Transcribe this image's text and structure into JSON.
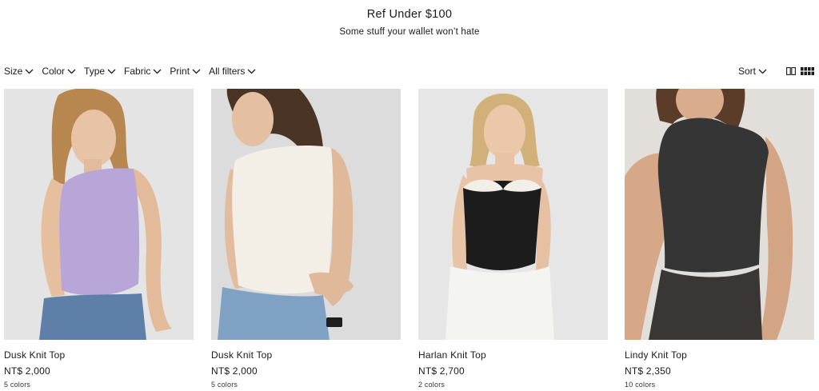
{
  "header": {
    "title": "Ref Under $100",
    "subtitle": "Some stuff your wallet won’t hate"
  },
  "filters": [
    {
      "label": "Size",
      "icon": "chevron-down-icon"
    },
    {
      "label": "Color",
      "icon": "chevron-down-icon"
    },
    {
      "label": "Type",
      "icon": "chevron-down-icon"
    },
    {
      "label": "Fabric",
      "icon": "chevron-down-icon"
    },
    {
      "label": "Print",
      "icon": "chevron-down-icon"
    },
    {
      "label": "All filters",
      "icon": "chevron-down-icon"
    }
  ],
  "sort": {
    "label": "Sort",
    "icon": "chevron-down-icon"
  },
  "view_toggle": {
    "two_column_icon": "grid-2-icon",
    "four_column_icon": "grid-4-icon",
    "active": "four"
  },
  "products": [
    {
      "name": "Dusk Knit Top",
      "price": "NT$ 2,000",
      "colors": "5 colors",
      "top_color": "#b9a6d9",
      "bg": "#e4e4e4",
      "hair": "#b8874f",
      "bottom_color": "#5e7fa8"
    },
    {
      "name": "Dusk Knit Top",
      "price": "NT$ 2,000",
      "colors": "5 colors",
      "top_color": "#f3eee6",
      "bg": "#dcdcdc",
      "hair": "#4a3426",
      "bottom_color": "#7fa2c4"
    },
    {
      "name": "Harlan Knit Top",
      "price": "NT$ 2,700",
      "colors": "2 colors",
      "top_color": "#1c1c1c",
      "bg": "#e6e6e6",
      "hair": "#d1b07a",
      "bottom_color": "#f4f4f1"
    },
    {
      "name": "Lindy Knit Top",
      "price": "NT$ 2,350",
      "colors": "10 colors",
      "top_color": "#353535",
      "bg": "#e2dfdb",
      "hair": "#5a3c28",
      "bottom_color": "#3a3634"
    }
  ]
}
